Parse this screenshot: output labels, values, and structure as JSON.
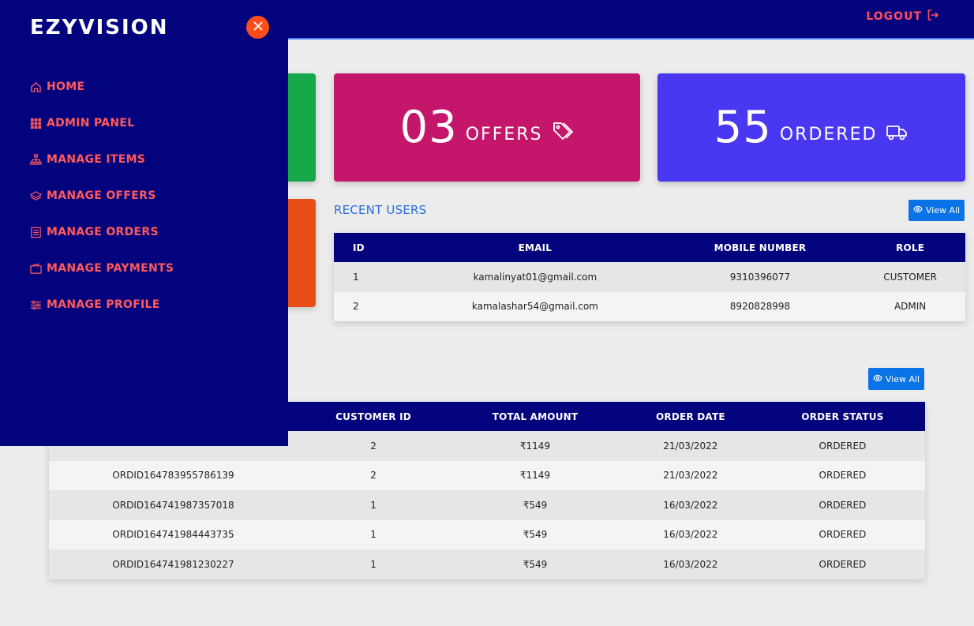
{
  "brand": "EZYVISION",
  "header": {
    "logout_label": "LOGOUT"
  },
  "sidebar": {
    "items": [
      {
        "label": "HOME",
        "icon": "home-icon"
      },
      {
        "label": "ADMIN PANEL",
        "icon": "grid-icon"
      },
      {
        "label": "MANAGE ITEMS",
        "icon": "sitemap-icon"
      },
      {
        "label": "MANAGE OFFERS",
        "icon": "layers-icon"
      },
      {
        "label": "MANAGE ORDERS",
        "icon": "document-icon"
      },
      {
        "label": "MANAGE PAYMENTS",
        "icon": "wallet-icon"
      },
      {
        "label": "MANAGE PROFILE",
        "icon": "sliders-icon"
      }
    ]
  },
  "stats": {
    "offers": {
      "value": "03",
      "label": "OFFERS",
      "color": "#c4166a"
    },
    "ordered": {
      "value": "55",
      "label": "ORDERED",
      "color": "#4a37f1"
    }
  },
  "recent_users": {
    "title": "RECENT USERS",
    "view_all": "View All",
    "columns": [
      "ID",
      "EMAIL",
      "MOBILE NUMBER",
      "ROLE"
    ],
    "rows": [
      [
        "1",
        "kamalinyat01@gmail.com",
        "9310396077",
        "CUSTOMER"
      ],
      [
        "2",
        "kamalashar54@gmail.com",
        "8920828998",
        "ADMIN"
      ]
    ]
  },
  "orders": {
    "view_all": "View All",
    "columns": [
      "",
      "CUSTOMER ID",
      "TOTAL AMOUNT",
      "ORDER DATE",
      "ORDER STATUS"
    ],
    "rows": [
      [
        "",
        "2",
        "₹1149",
        "21/03/2022",
        "ORDERED"
      ],
      [
        "ORDID164783955786139",
        "2",
        "₹1149",
        "21/03/2022",
        "ORDERED"
      ],
      [
        "ORDID164741987357018",
        "1",
        "₹549",
        "16/03/2022",
        "ORDERED"
      ],
      [
        "ORDID164741984443735",
        "1",
        "₹549",
        "16/03/2022",
        "ORDERED"
      ],
      [
        "ORDID164741981230227",
        "1",
        "₹549",
        "16/03/2022",
        "ORDERED"
      ]
    ]
  },
  "colors": {
    "navy": "#04037e",
    "accent_red": "#ff4d5e",
    "link_blue": "#2a6fdb",
    "button_blue": "#0b73e8"
  }
}
